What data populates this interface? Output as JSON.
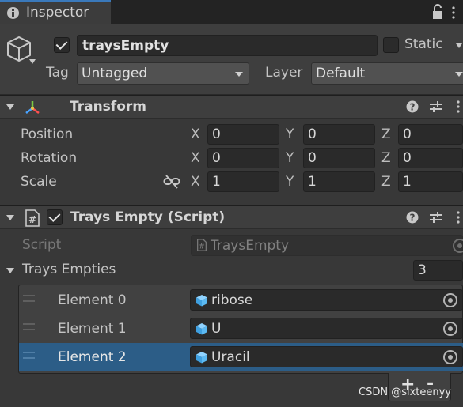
{
  "tab": {
    "title": "Inspector"
  },
  "object": {
    "name": "traysEmpty",
    "static_label": "Static",
    "tag_label": "Tag",
    "tag_value": "Untagged",
    "layer_label": "Layer",
    "layer_value": "Default"
  },
  "transform": {
    "title": "Transform",
    "rows": [
      {
        "label": "Position",
        "x": "0",
        "y": "0",
        "z": "0"
      },
      {
        "label": "Rotation",
        "x": "0",
        "y": "0",
        "z": "0"
      },
      {
        "label": "Scale",
        "x": "1",
        "y": "1",
        "z": "1"
      }
    ],
    "axis_x": "X",
    "axis_y": "Y",
    "axis_z": "Z"
  },
  "script_component": {
    "title": "Trays Empty (Script)",
    "script_label": "Script",
    "script_value": "TraysEmpty",
    "list_label": "Trays Empties",
    "list_size": "3",
    "elements": [
      {
        "label": "Element 0",
        "value": "ribose",
        "selected": false
      },
      {
        "label": "Element 1",
        "value": "U",
        "selected": false
      },
      {
        "label": "Element 2",
        "value": "Uracil",
        "selected": true
      }
    ],
    "add_label": "+",
    "remove_label": "-"
  },
  "watermark": "CSDN @sixteenyy",
  "colors": {
    "panel": "#383838",
    "header": "#3e3e3e",
    "field": "#2a2a2a",
    "selected_row": "#2c5d87",
    "accent": "#3a79bb"
  }
}
